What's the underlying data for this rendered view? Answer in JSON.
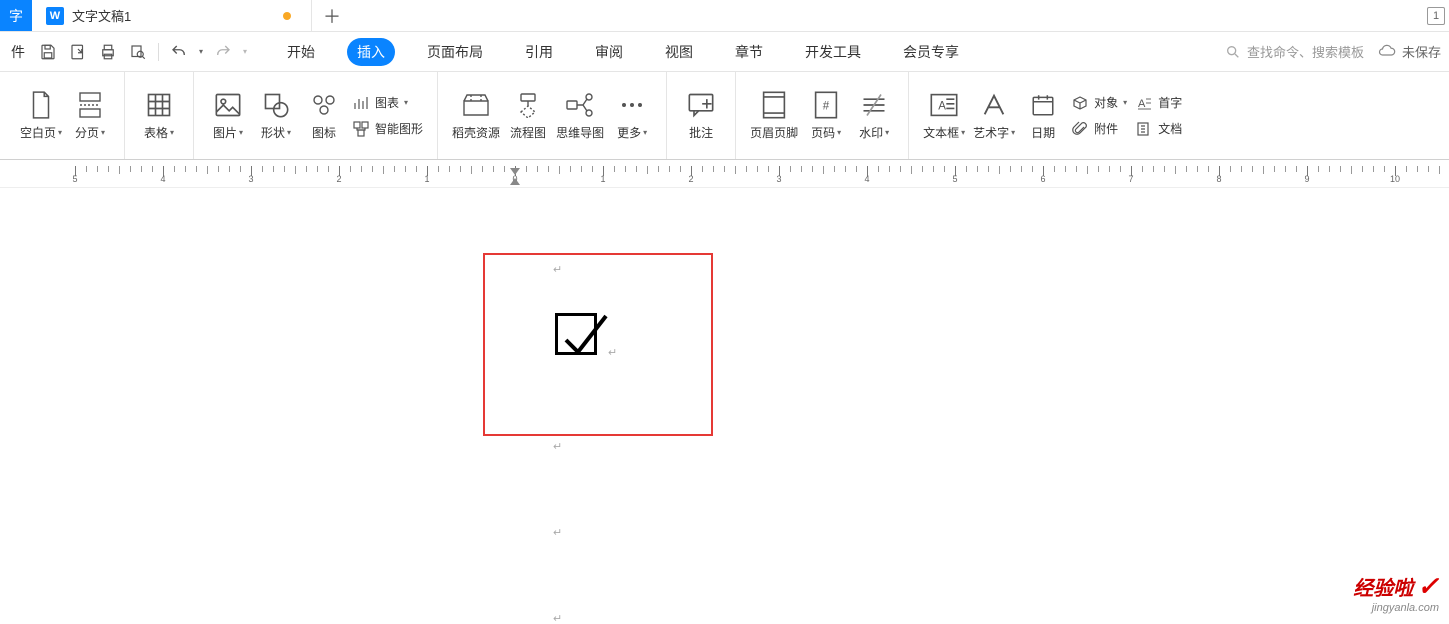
{
  "titlebar": {
    "app_char": "字",
    "doc_icon": "W",
    "doc_title": "文字文稿1",
    "new_tab": "＋",
    "one_badge": "1"
  },
  "qat": {
    "file_char": "件"
  },
  "menu": {
    "tabs": [
      "开始",
      "插入",
      "页面布局",
      "引用",
      "审阅",
      "视图",
      "章节",
      "开发工具",
      "会员专享"
    ],
    "active_index": 1,
    "search_placeholder": "查找命令、搜索模板",
    "unsaved": "未保存"
  },
  "ribbon": {
    "blank_page": "空白页",
    "page_break": "分页",
    "table": "表格",
    "picture": "图片",
    "shape": "形状",
    "icon": "图标",
    "chart": "图表",
    "smart_art": "智能图形",
    "resources": "稻壳资源",
    "flowchart": "流程图",
    "mindmap": "思维导图",
    "more": "更多",
    "comment": "批注",
    "header_footer": "页眉页脚",
    "page_number": "页码",
    "watermark": "水印",
    "textbox": "文本框",
    "wordart": "艺术字",
    "date": "日期",
    "object": "对象",
    "attachment": "附件",
    "drop_cap": "首字",
    "doc_parts": "文档"
  },
  "watermark": {
    "main": "经验啦",
    "sub": "jingyanla.com"
  }
}
